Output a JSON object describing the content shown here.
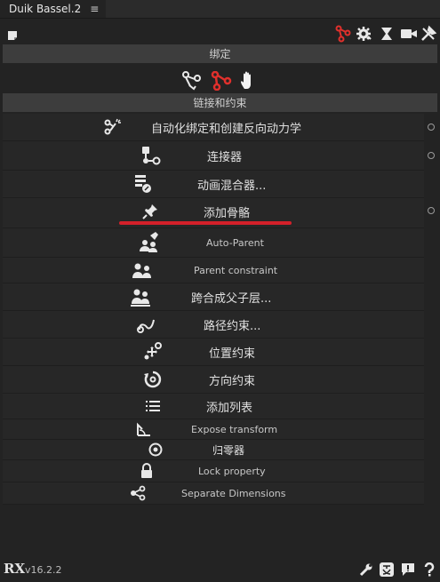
{
  "tab": {
    "title": "Duik Bassel.2",
    "menu_glyph": "≡"
  },
  "toolbar": {
    "icons": [
      "note-icon",
      "rig-icon",
      "gear-icon",
      "hourglass-icon",
      "camera-icon",
      "tools-icon"
    ]
  },
  "sections": {
    "rigging": "绑定",
    "links": "链接和约束"
  },
  "items": [
    {
      "label": "自动化绑定和创建反向动力学",
      "icon": "auto-rig-icon"
    },
    {
      "label": "连接器",
      "icon": "connector-icon"
    },
    {
      "label": "动画混合器...",
      "icon": "blender-icon"
    },
    {
      "label": "添加骨骼",
      "icon": "pin-icon"
    },
    {
      "label": "Auto-Parent",
      "icon": "auto-parent-icon"
    },
    {
      "label": "Parent constraint",
      "icon": "parent-constraint-icon"
    },
    {
      "label": "跨合成父子层...",
      "icon": "parent-across-comps-icon"
    },
    {
      "label": "路径约束...",
      "icon": "path-constraint-icon"
    },
    {
      "label": "位置约束",
      "icon": "position-constraint-icon"
    },
    {
      "label": "方向约束",
      "icon": "orientation-constraint-icon"
    },
    {
      "label": "添加列表",
      "icon": "list-icon"
    },
    {
      "label": "Expose transform",
      "icon": "expose-transform-icon"
    },
    {
      "label": "归零器",
      "icon": "zero-icon"
    },
    {
      "label": "Lock property",
      "icon": "lock-icon"
    },
    {
      "label": "Separate Dimensions",
      "icon": "separate-dimensions-icon"
    }
  ],
  "footer": {
    "logo": "RX",
    "version": "v16.2.2"
  },
  "colors": {
    "accent_red": "#d4202a",
    "panel": "#232323",
    "row": "#272727",
    "header": "#3d3d3d"
  }
}
